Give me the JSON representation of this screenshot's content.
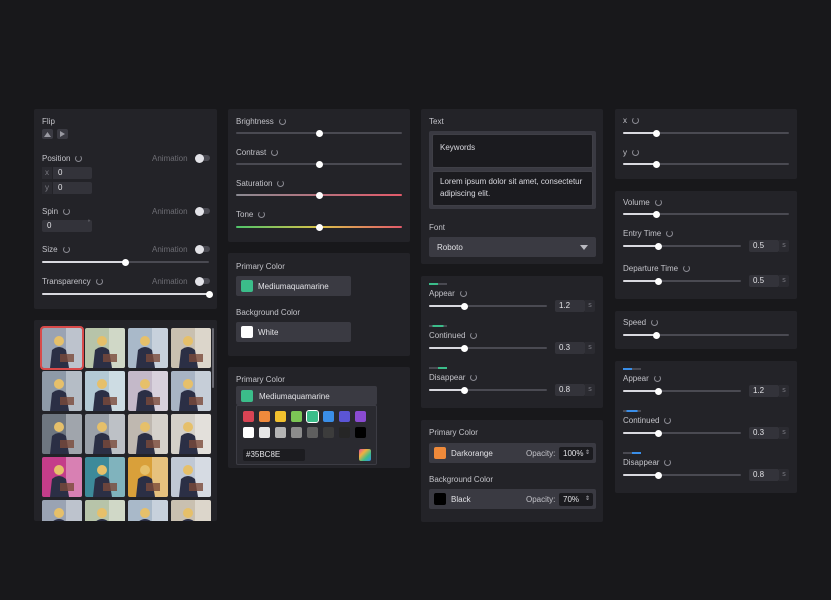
{
  "transform": {
    "flip_label": "Flip",
    "position_label": "Position",
    "animation_label": "Animation",
    "x_prefix": "x",
    "y_prefix": "y",
    "x_value": "0",
    "y_value": "0",
    "spin_label": "Spin",
    "spin_value": "0",
    "spin_unit": "°",
    "size_label": "Size",
    "size_level": 0.5,
    "transparency_label": "Transparency",
    "transparency_level": 1.0
  },
  "adjust": {
    "brightness_label": "Brightness",
    "brightness_level": 0.5,
    "contrast_label": "Contrast",
    "contrast_level": 0.5,
    "saturation_label": "Saturation",
    "saturation_level": 0.5,
    "tone_label": "Tone",
    "tone_level": 0.5
  },
  "colors1": {
    "primary_label": "Primary Color",
    "primary_name": "Mediumaquamarine",
    "primary_hex": "#3bbd8a",
    "background_label": "Background Color",
    "background_name": "White",
    "background_hex": "#ffffff"
  },
  "picker": {
    "label": "Primary Color",
    "selected_name": "Mediumaquamarine",
    "selected_hex": "#3bbd8a",
    "hex_value": "#35BC8E",
    "row1": [
      "#d94454",
      "#f08a3c",
      "#f2c12e",
      "#7bc655",
      "#3bbd8a",
      "#3a8ee8",
      "#5b55d6",
      "#8a4bd1"
    ],
    "row2": [
      "#ffffff",
      "#e6e6e6",
      "#b4b4b4",
      "#8c8c8c",
      "#5f5f5f",
      "#3c3c3c",
      "#262626",
      "#000000"
    ]
  },
  "text_panel": {
    "text_label": "Text",
    "keywords": "Keywords",
    "body_text_1": "Lorem ipsum dolor sit amet, consectetur",
    "body_text_2": "adipiscing elit.",
    "font_label": "Font",
    "font_value": "Roboto"
  },
  "anim1": {
    "appear_label": "Appear",
    "appear_value": "1.2",
    "appear_level": 0.3,
    "continued_label": "Continued",
    "continued_value": "0.3",
    "continued_level": 0.3,
    "disappear_label": "Disappear",
    "disappear_value": "0.8",
    "disappear_level": 0.3,
    "unit": "s"
  },
  "colors2": {
    "primary_label": "Primary Color",
    "primary_name": "Darkorange",
    "primary_hex": "#ef8a3a",
    "primary_opacity_label": "Opacity:",
    "primary_opacity": "100%",
    "background_label": "Background Color",
    "background_name": "Black",
    "background_hex": "#000000",
    "background_opacity_label": "Opacity:",
    "background_opacity": "70%"
  },
  "xy": {
    "x_label": "x",
    "x_level": 0.2,
    "y_label": "y",
    "y_level": 0.2
  },
  "audio": {
    "volume_label": "Volume",
    "volume_level": 0.2,
    "entry_label": "Entry Time",
    "entry_value": "0.5",
    "entry_level": 0.3,
    "departure_label": "Departure Time",
    "departure_value": "0.5",
    "departure_level": 0.3,
    "unit": "s"
  },
  "speed": {
    "label": "Speed",
    "level": 0.2
  },
  "anim2": {
    "appear_label": "Appear",
    "appear_value": "1.2",
    "appear_level": 0.3,
    "continued_label": "Continued",
    "continued_value": "0.3",
    "continued_level": 0.3,
    "disappear_label": "Disappear",
    "disappear_value": "0.8",
    "disappear_level": 0.3,
    "unit": "s"
  },
  "filters": {
    "selected_index": 0,
    "thumbnail_tints": [
      "#9aa3b3",
      "#b7c4a9",
      "#a9b9c9",
      "#c9c0b0",
      "#8e9aa8",
      "#b3c9d4",
      "#c4b9c9",
      "#a8b4c4",
      "#6e7680",
      "#9aa0a8",
      "#bfb8b0",
      "#d4d0c8",
      "#c43d8a",
      "#3d8a9a",
      "#d9a03a",
      "#c0c8d4",
      "#9aa3b3",
      "#b7c4a9",
      "#a9b9c9",
      "#c9c0b0"
    ]
  }
}
